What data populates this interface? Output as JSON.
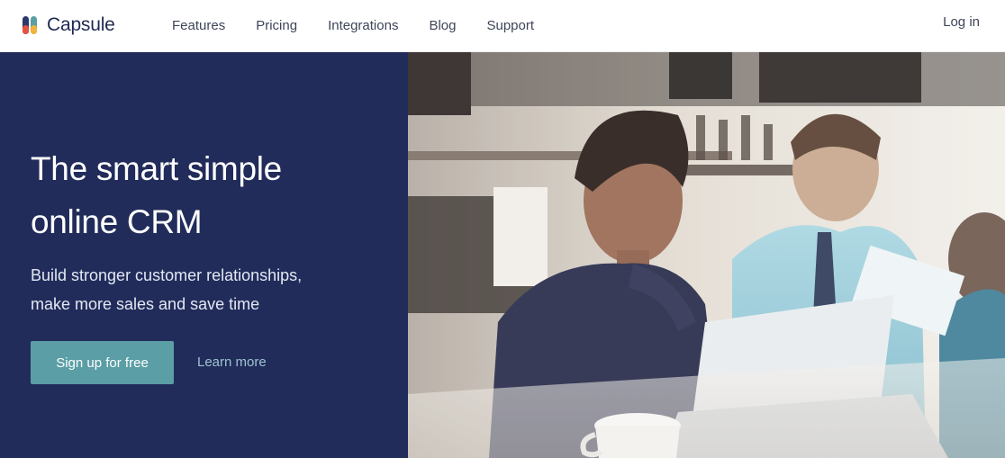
{
  "brand": {
    "name": "Capsule",
    "logo_icon": "capsule-logo-icon"
  },
  "nav": {
    "items": [
      {
        "label": "Features"
      },
      {
        "label": "Pricing"
      },
      {
        "label": "Integrations"
      },
      {
        "label": "Blog"
      },
      {
        "label": "Support"
      }
    ],
    "login_label": "Log in"
  },
  "hero": {
    "headline_line1": "The smart simple",
    "headline_line2": "online CRM",
    "subhead_line1": "Build stronger customer relationships,",
    "subhead_line2": "make more sales and save time",
    "cta_label": "Sign up for free",
    "secondary_link_label": "Learn more",
    "photo": "people-working-on-laptops-in-cafe"
  },
  "colors": {
    "hero_background": "#212c5b",
    "cta_button": "#5b9ea6",
    "learn_more_link": "#9fc4cf",
    "brand_text": "#1f2a52"
  }
}
